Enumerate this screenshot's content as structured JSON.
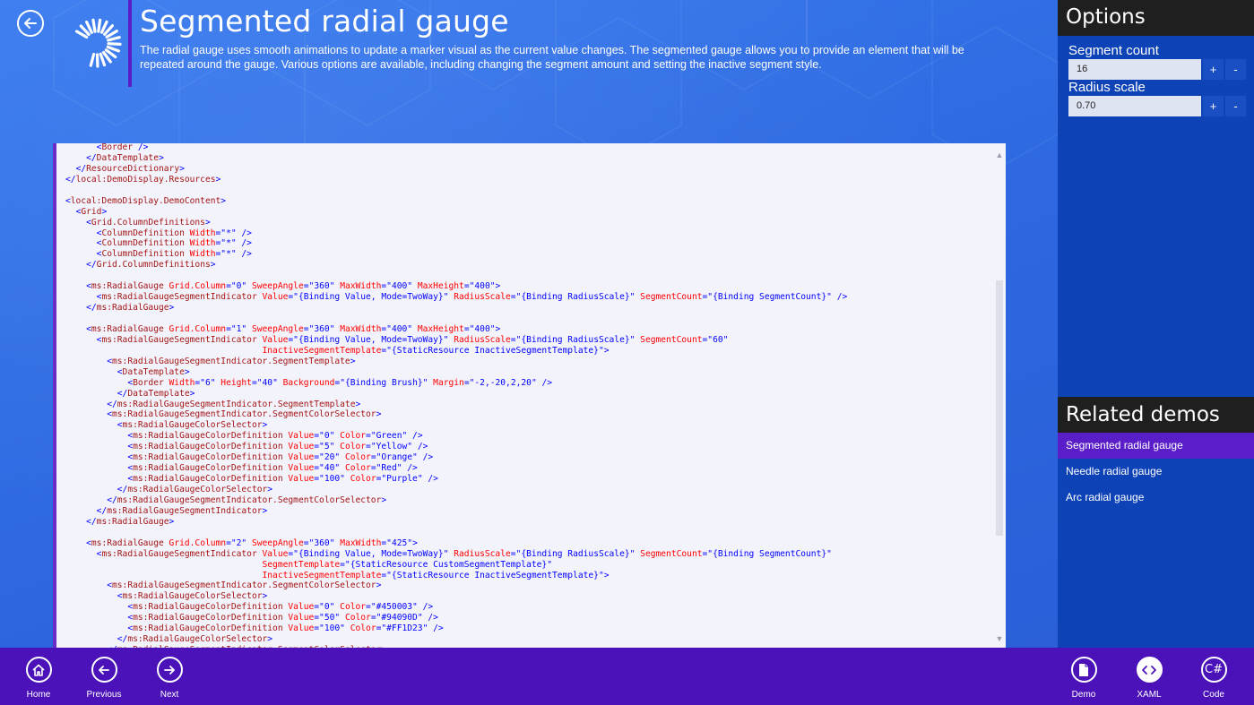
{
  "header": {
    "title": "Segmented radial gauge",
    "description": "The radial gauge uses smooth animations to update a marker visual as the current value changes. The segmented gauge allows you to provide an element that will be repeated around the gauge. Various options are available, including changing the segment amount and setting the inactive segment style."
  },
  "options": {
    "title": "Options",
    "segment_count_label": "Segment count",
    "segment_count_value": "16",
    "radius_scale_label": "Radius scale",
    "radius_scale_value": "0.70",
    "plus": "+",
    "minus": "-"
  },
  "related": {
    "title": "Related demos",
    "items": [
      "Segmented radial gauge",
      "Needle radial gauge",
      "Arc radial gauge"
    ]
  },
  "appbar": {
    "home": "Home",
    "previous": "Previous",
    "next": "Next",
    "demo": "Demo",
    "xaml": "XAML",
    "code": "Code"
  },
  "code": [
    [
      6,
      [
        [
          "b",
          "<"
        ],
        [
          "t",
          "Border"
        ],
        [
          "b",
          " />"
        ]
      ]
    ],
    [
      4,
      [
        [
          "b",
          "</"
        ],
        [
          "t",
          "DataTemplate"
        ],
        [
          "b",
          ">"
        ]
      ]
    ],
    [
      2,
      [
        [
          "b",
          "</"
        ],
        [
          "t",
          "ResourceDictionary"
        ],
        [
          "b",
          ">"
        ]
      ]
    ],
    [
      0,
      [
        [
          "b",
          "</"
        ],
        [
          "t",
          "local:DemoDisplay.Resources"
        ],
        [
          "b",
          ">"
        ]
      ]
    ],
    [
      0,
      []
    ],
    [
      0,
      [
        [
          "b",
          "<"
        ],
        [
          "t",
          "local:DemoDisplay.DemoContent"
        ],
        [
          "b",
          ">"
        ]
      ]
    ],
    [
      2,
      [
        [
          "b",
          "<"
        ],
        [
          "t",
          "Grid"
        ],
        [
          "b",
          ">"
        ]
      ]
    ],
    [
      4,
      [
        [
          "b",
          "<"
        ],
        [
          "t",
          "Grid.ColumnDefinitions"
        ],
        [
          "b",
          ">"
        ]
      ]
    ],
    [
      6,
      [
        [
          "b",
          "<"
        ],
        [
          "t",
          "ColumnDefinition"
        ],
        [
          "a",
          " Width"
        ],
        [
          "b",
          "=\""
        ],
        [
          "v",
          "*"
        ],
        [
          "b",
          "\" />"
        ]
      ]
    ],
    [
      6,
      [
        [
          "b",
          "<"
        ],
        [
          "t",
          "ColumnDefinition"
        ],
        [
          "a",
          " Width"
        ],
        [
          "b",
          "=\""
        ],
        [
          "v",
          "*"
        ],
        [
          "b",
          "\" />"
        ]
      ]
    ],
    [
      6,
      [
        [
          "b",
          "<"
        ],
        [
          "t",
          "ColumnDefinition"
        ],
        [
          "a",
          " Width"
        ],
        [
          "b",
          "=\""
        ],
        [
          "v",
          "*"
        ],
        [
          "b",
          "\" />"
        ]
      ]
    ],
    [
      4,
      [
        [
          "b",
          "</"
        ],
        [
          "t",
          "Grid.ColumnDefinitions"
        ],
        [
          "b",
          ">"
        ]
      ]
    ],
    [
      0,
      []
    ],
    [
      4,
      [
        [
          "b",
          "<"
        ],
        [
          "t",
          "ms:RadialGauge"
        ],
        [
          "a",
          " Grid.Column"
        ],
        [
          "b",
          "=\""
        ],
        [
          "v",
          "0"
        ],
        [
          "b",
          "\""
        ],
        [
          "a",
          " SweepAngle"
        ],
        [
          "b",
          "=\""
        ],
        [
          "v",
          "360"
        ],
        [
          "b",
          "\""
        ],
        [
          "a",
          " MaxWidth"
        ],
        [
          "b",
          "=\""
        ],
        [
          "v",
          "400"
        ],
        [
          "b",
          "\""
        ],
        [
          "a",
          " MaxHeight"
        ],
        [
          "b",
          "=\""
        ],
        [
          "v",
          "400"
        ],
        [
          "b",
          "\">"
        ]
      ]
    ],
    [
      6,
      [
        [
          "b",
          "<"
        ],
        [
          "t",
          "ms:RadialGaugeSegmentIndicator"
        ],
        [
          "a",
          " Value"
        ],
        [
          "b",
          "=\""
        ],
        [
          "v",
          "{Binding Value, Mode=TwoWay}"
        ],
        [
          "b",
          "\""
        ],
        [
          "a",
          " RadiusScale"
        ],
        [
          "b",
          "=\""
        ],
        [
          "v",
          "{Binding RadiusScale}"
        ],
        [
          "b",
          "\""
        ],
        [
          "a",
          " SegmentCount"
        ],
        [
          "b",
          "=\""
        ],
        [
          "v",
          "{Binding SegmentCount}"
        ],
        [
          "b",
          "\" />"
        ]
      ]
    ],
    [
      4,
      [
        [
          "b",
          "</"
        ],
        [
          "t",
          "ms:RadialGauge"
        ],
        [
          "b",
          ">"
        ]
      ]
    ],
    [
      0,
      []
    ],
    [
      4,
      [
        [
          "b",
          "<"
        ],
        [
          "t",
          "ms:RadialGauge"
        ],
        [
          "a",
          " Grid.Column"
        ],
        [
          "b",
          "=\""
        ],
        [
          "v",
          "1"
        ],
        [
          "b",
          "\""
        ],
        [
          "a",
          " SweepAngle"
        ],
        [
          "b",
          "=\""
        ],
        [
          "v",
          "360"
        ],
        [
          "b",
          "\""
        ],
        [
          "a",
          " MaxWidth"
        ],
        [
          "b",
          "=\""
        ],
        [
          "v",
          "400"
        ],
        [
          "b",
          "\""
        ],
        [
          "a",
          " MaxHeight"
        ],
        [
          "b",
          "=\""
        ],
        [
          "v",
          "400"
        ],
        [
          "b",
          "\">"
        ]
      ]
    ],
    [
      6,
      [
        [
          "b",
          "<"
        ],
        [
          "t",
          "ms:RadialGaugeSegmentIndicator"
        ],
        [
          "a",
          " Value"
        ],
        [
          "b",
          "=\""
        ],
        [
          "v",
          "{Binding Value, Mode=TwoWay}"
        ],
        [
          "b",
          "\""
        ],
        [
          "a",
          " RadiusScale"
        ],
        [
          "b",
          "=\""
        ],
        [
          "v",
          "{Binding RadiusScale}"
        ],
        [
          "b",
          "\""
        ],
        [
          "a",
          " SegmentCount"
        ],
        [
          "b",
          "=\""
        ],
        [
          "v",
          "60"
        ],
        [
          "b",
          "\""
        ]
      ]
    ],
    [
      38,
      [
        [
          "a",
          "InactiveSegmentTemplate"
        ],
        [
          "b",
          "=\""
        ],
        [
          "v",
          "{StaticResource InactiveSegmentTemplate}"
        ],
        [
          "b",
          "\">"
        ]
      ]
    ],
    [
      8,
      [
        [
          "b",
          "<"
        ],
        [
          "t",
          "ms:RadialGaugeSegmentIndicator.SegmentTemplate"
        ],
        [
          "b",
          ">"
        ]
      ]
    ],
    [
      10,
      [
        [
          "b",
          "<"
        ],
        [
          "t",
          "DataTemplate"
        ],
        [
          "b",
          ">"
        ]
      ]
    ],
    [
      12,
      [
        [
          "b",
          "<"
        ],
        [
          "t",
          "Border"
        ],
        [
          "a",
          " Width"
        ],
        [
          "b",
          "=\""
        ],
        [
          "v",
          "6"
        ],
        [
          "b",
          "\""
        ],
        [
          "a",
          " Height"
        ],
        [
          "b",
          "=\""
        ],
        [
          "v",
          "40"
        ],
        [
          "b",
          "\""
        ],
        [
          "a",
          " Background"
        ],
        [
          "b",
          "=\""
        ],
        [
          "v",
          "{Binding Brush}"
        ],
        [
          "b",
          "\""
        ],
        [
          "a",
          " Margin"
        ],
        [
          "b",
          "=\""
        ],
        [
          "v",
          "-2,-20,2,20"
        ],
        [
          "b",
          "\" />"
        ]
      ]
    ],
    [
      10,
      [
        [
          "b",
          "</"
        ],
        [
          "t",
          "DataTemplate"
        ],
        [
          "b",
          ">"
        ]
      ]
    ],
    [
      8,
      [
        [
          "b",
          "</"
        ],
        [
          "t",
          "ms:RadialGaugeSegmentIndicator.SegmentTemplate"
        ],
        [
          "b",
          ">"
        ]
      ]
    ],
    [
      8,
      [
        [
          "b",
          "<"
        ],
        [
          "t",
          "ms:RadialGaugeSegmentIndicator.SegmentColorSelector"
        ],
        [
          "b",
          ">"
        ]
      ]
    ],
    [
      10,
      [
        [
          "b",
          "<"
        ],
        [
          "t",
          "ms:RadialGaugeColorSelector"
        ],
        [
          "b",
          ">"
        ]
      ]
    ],
    [
      12,
      [
        [
          "b",
          "<"
        ],
        [
          "t",
          "ms:RadialGaugeColorDefinition"
        ],
        [
          "a",
          " Value"
        ],
        [
          "b",
          "=\""
        ],
        [
          "v",
          "0"
        ],
        [
          "b",
          "\""
        ],
        [
          "a",
          " Color"
        ],
        [
          "b",
          "=\""
        ],
        [
          "v",
          "Green"
        ],
        [
          "b",
          "\" />"
        ]
      ]
    ],
    [
      12,
      [
        [
          "b",
          "<"
        ],
        [
          "t",
          "ms:RadialGaugeColorDefinition"
        ],
        [
          "a",
          " Value"
        ],
        [
          "b",
          "=\""
        ],
        [
          "v",
          "5"
        ],
        [
          "b",
          "\""
        ],
        [
          "a",
          " Color"
        ],
        [
          "b",
          "=\""
        ],
        [
          "v",
          "Yellow"
        ],
        [
          "b",
          "\" />"
        ]
      ]
    ],
    [
      12,
      [
        [
          "b",
          "<"
        ],
        [
          "t",
          "ms:RadialGaugeColorDefinition"
        ],
        [
          "a",
          " Value"
        ],
        [
          "b",
          "=\""
        ],
        [
          "v",
          "20"
        ],
        [
          "b",
          "\""
        ],
        [
          "a",
          " Color"
        ],
        [
          "b",
          "=\""
        ],
        [
          "v",
          "Orange"
        ],
        [
          "b",
          "\" />"
        ]
      ]
    ],
    [
      12,
      [
        [
          "b",
          "<"
        ],
        [
          "t",
          "ms:RadialGaugeColorDefinition"
        ],
        [
          "a",
          " Value"
        ],
        [
          "b",
          "=\""
        ],
        [
          "v",
          "40"
        ],
        [
          "b",
          "\""
        ],
        [
          "a",
          " Color"
        ],
        [
          "b",
          "=\""
        ],
        [
          "v",
          "Red"
        ],
        [
          "b",
          "\" />"
        ]
      ]
    ],
    [
      12,
      [
        [
          "b",
          "<"
        ],
        [
          "t",
          "ms:RadialGaugeColorDefinition"
        ],
        [
          "a",
          " Value"
        ],
        [
          "b",
          "=\""
        ],
        [
          "v",
          "100"
        ],
        [
          "b",
          "\""
        ],
        [
          "a",
          " Color"
        ],
        [
          "b",
          "=\""
        ],
        [
          "v",
          "Purple"
        ],
        [
          "b",
          "\" />"
        ]
      ]
    ],
    [
      10,
      [
        [
          "b",
          "</"
        ],
        [
          "t",
          "ms:RadialGaugeColorSelector"
        ],
        [
          "b",
          ">"
        ]
      ]
    ],
    [
      8,
      [
        [
          "b",
          "</"
        ],
        [
          "t",
          "ms:RadialGaugeSegmentIndicator.SegmentColorSelector"
        ],
        [
          "b",
          ">"
        ]
      ]
    ],
    [
      6,
      [
        [
          "b",
          "</"
        ],
        [
          "t",
          "ms:RadialGaugeSegmentIndicator"
        ],
        [
          "b",
          ">"
        ]
      ]
    ],
    [
      4,
      [
        [
          "b",
          "</"
        ],
        [
          "t",
          "ms:RadialGauge"
        ],
        [
          "b",
          ">"
        ]
      ]
    ],
    [
      0,
      []
    ],
    [
      4,
      [
        [
          "b",
          "<"
        ],
        [
          "t",
          "ms:RadialGauge"
        ],
        [
          "a",
          " Grid.Column"
        ],
        [
          "b",
          "=\""
        ],
        [
          "v",
          "2"
        ],
        [
          "b",
          "\""
        ],
        [
          "a",
          " SweepAngle"
        ],
        [
          "b",
          "=\""
        ],
        [
          "v",
          "360"
        ],
        [
          "b",
          "\""
        ],
        [
          "a",
          " MaxWidth"
        ],
        [
          "b",
          "=\""
        ],
        [
          "v",
          "425"
        ],
        [
          "b",
          "\">"
        ]
      ]
    ],
    [
      6,
      [
        [
          "b",
          "<"
        ],
        [
          "t",
          "ms:RadialGaugeSegmentIndicator"
        ],
        [
          "a",
          " Value"
        ],
        [
          "b",
          "=\""
        ],
        [
          "v",
          "{Binding Value, Mode=TwoWay}"
        ],
        [
          "b",
          "\""
        ],
        [
          "a",
          " RadiusScale"
        ],
        [
          "b",
          "=\""
        ],
        [
          "v",
          "{Binding RadiusScale}"
        ],
        [
          "b",
          "\""
        ],
        [
          "a",
          " SegmentCount"
        ],
        [
          "b",
          "=\""
        ],
        [
          "v",
          "{Binding SegmentCount}"
        ],
        [
          "b",
          "\""
        ]
      ]
    ],
    [
      38,
      [
        [
          "a",
          "SegmentTemplate"
        ],
        [
          "b",
          "=\""
        ],
        [
          "v",
          "{StaticResource CustomSegmentTemplate}"
        ],
        [
          "b",
          "\""
        ]
      ]
    ],
    [
      38,
      [
        [
          "a",
          "InactiveSegmentTemplate"
        ],
        [
          "b",
          "=\""
        ],
        [
          "v",
          "{StaticResource InactiveSegmentTemplate}"
        ],
        [
          "b",
          "\">"
        ]
      ]
    ],
    [
      8,
      [
        [
          "b",
          "<"
        ],
        [
          "t",
          "ms:RadialGaugeSegmentIndicator.SegmentColorSelector"
        ],
        [
          "b",
          ">"
        ]
      ]
    ],
    [
      10,
      [
        [
          "b",
          "<"
        ],
        [
          "t",
          "ms:RadialGaugeColorSelector"
        ],
        [
          "b",
          ">"
        ]
      ]
    ],
    [
      12,
      [
        [
          "b",
          "<"
        ],
        [
          "t",
          "ms:RadialGaugeColorDefinition"
        ],
        [
          "a",
          " Value"
        ],
        [
          "b",
          "=\""
        ],
        [
          "v",
          "0"
        ],
        [
          "b",
          "\""
        ],
        [
          "a",
          " Color"
        ],
        [
          "b",
          "=\""
        ],
        [
          "v",
          "#450003"
        ],
        [
          "b",
          "\" />"
        ]
      ]
    ],
    [
      12,
      [
        [
          "b",
          "<"
        ],
        [
          "t",
          "ms:RadialGaugeColorDefinition"
        ],
        [
          "a",
          " Value"
        ],
        [
          "b",
          "=\""
        ],
        [
          "v",
          "50"
        ],
        [
          "b",
          "\""
        ],
        [
          "a",
          " Color"
        ],
        [
          "b",
          "=\""
        ],
        [
          "v",
          "#94090D"
        ],
        [
          "b",
          "\" />"
        ]
      ]
    ],
    [
      12,
      [
        [
          "b",
          "<"
        ],
        [
          "t",
          "ms:RadialGaugeColorDefinition"
        ],
        [
          "a",
          " Value"
        ],
        [
          "b",
          "=\""
        ],
        [
          "v",
          "100"
        ],
        [
          "b",
          "\""
        ],
        [
          "a",
          " Color"
        ],
        [
          "b",
          "=\""
        ],
        [
          "v",
          "#FF1D23"
        ],
        [
          "b",
          "\" />"
        ]
      ]
    ],
    [
      10,
      [
        [
          "b",
          "</"
        ],
        [
          "t",
          "ms:RadialGaugeColorSelector"
        ],
        [
          "b",
          ">"
        ]
      ]
    ],
    [
      8,
      [
        [
          "b",
          "</"
        ],
        [
          "t",
          "ms:RadialGaugeSegmentIndicator.SegmentColorSelector"
        ],
        [
          "b",
          ">"
        ]
      ]
    ]
  ]
}
